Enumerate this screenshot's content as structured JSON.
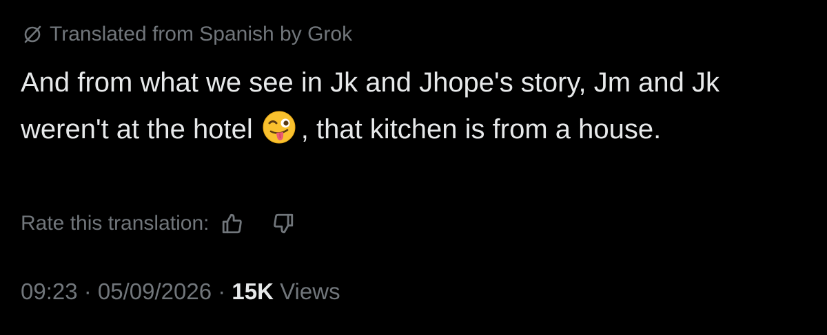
{
  "translation_notice": {
    "icon": "translate-slash-icon",
    "text": "Translated from Spanish by Grok"
  },
  "tweet": {
    "line_part_1": "And from what we see in Jk and Jhope's story, Jm and Jk weren't at the hotel",
    "emoji": "winking-face-with-tongue-emoji",
    "line_part_2": ", that kitchen is from a house."
  },
  "rate": {
    "label": "Rate this translation:",
    "thumbs_up_icon": "thumbs-up-icon",
    "thumbs_down_icon": "thumbs-down-icon"
  },
  "meta": {
    "time": "09:23",
    "separator": " · ",
    "date": "05/09/2026",
    "views_count": "15K",
    "views_label": "Views"
  },
  "colors": {
    "background": "#000000",
    "primary_text": "#e7e9ea",
    "secondary_text": "#71767b",
    "emoji_face": "#f9c12e"
  }
}
